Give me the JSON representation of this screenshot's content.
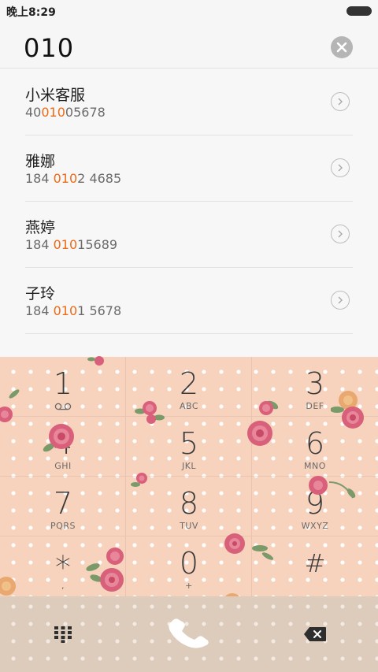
{
  "status_bar": {
    "time": "晚上8:29"
  },
  "search": {
    "query": "010"
  },
  "results": [
    {
      "name": "小米客服",
      "number_pre": "40",
      "number_match": "010",
      "number_post": "05678"
    },
    {
      "name": "雅娜",
      "number_pre": "184 ",
      "number_match": "010",
      "number_post": "2 4685"
    },
    {
      "name": "燕婷",
      "number_pre": "184 ",
      "number_match": "010",
      "number_post": "15689"
    },
    {
      "name": "子玲",
      "number_pre": "184 ",
      "number_match": "010",
      "number_post": "1 5678"
    }
  ],
  "dialpad": {
    "keys": [
      {
        "digit": "1",
        "letters": ""
      },
      {
        "digit": "2",
        "letters": "ABC"
      },
      {
        "digit": "3",
        "letters": "DEF"
      },
      {
        "digit": "4",
        "letters": "GHI"
      },
      {
        "digit": "5",
        "letters": "JKL"
      },
      {
        "digit": "6",
        "letters": "MNO"
      },
      {
        "digit": "7",
        "letters": "PQRS"
      },
      {
        "digit": "8",
        "letters": "TUV"
      },
      {
        "digit": "9",
        "letters": "WXYZ"
      },
      {
        "digit": "*",
        "letters": ","
      },
      {
        "digit": "0",
        "letters": "+"
      },
      {
        "digit": "#",
        "letters": ""
      }
    ]
  },
  "colors": {
    "match_highlight": "#ee6a16",
    "dialpad_background": "#f7d3bd",
    "bottom_bar_background": "#ddcbbb",
    "rose": "#d9607a"
  },
  "icons": {
    "clear": "close-icon",
    "detail": "chevron-right-icon",
    "voicemail": "voicemail-icon",
    "keypad_toggle": "dialpad-icon",
    "call": "phone-icon",
    "delete": "backspace-icon"
  }
}
